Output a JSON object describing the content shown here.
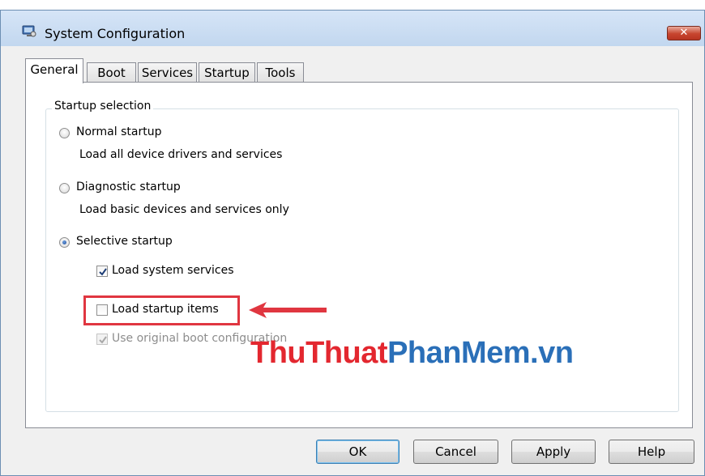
{
  "window": {
    "title": "System Configuration",
    "close_icon": "close-x-icon"
  },
  "tabs": [
    {
      "label": "General",
      "active": true
    },
    {
      "label": "Boot",
      "active": false
    },
    {
      "label": "Services",
      "active": false
    },
    {
      "label": "Startup",
      "active": false
    },
    {
      "label": "Tools",
      "active": false
    }
  ],
  "startup_selection": {
    "legend": "Startup selection",
    "normal": {
      "label": "Normal startup",
      "description": "Load all device drivers and services",
      "selected": false
    },
    "diagnostic": {
      "label": "Diagnostic startup",
      "description": "Load basic devices and services only",
      "selected": false
    },
    "selective": {
      "label": "Selective startup",
      "selected": true
    },
    "options": {
      "load_system_services": {
        "label": "Load system services",
        "checked": true,
        "enabled": true
      },
      "load_startup_items": {
        "label": "Load startup items",
        "checked": false,
        "enabled": true
      },
      "use_original_boot": {
        "label": "Use original boot configuration",
        "checked": true,
        "enabled": false
      }
    }
  },
  "annotation": {
    "highlight_color": "#e03640",
    "arrow_icon": "left-arrow-icon"
  },
  "watermark": {
    "part1": "ThuThuat",
    "part2": "PhanMem",
    "part3": ".vn",
    "color_red": "#e3272f",
    "color_blue": "#2a6fb8"
  },
  "buttons": {
    "ok": "OK",
    "cancel": "Cancel",
    "apply": "Apply",
    "help": "Help"
  }
}
